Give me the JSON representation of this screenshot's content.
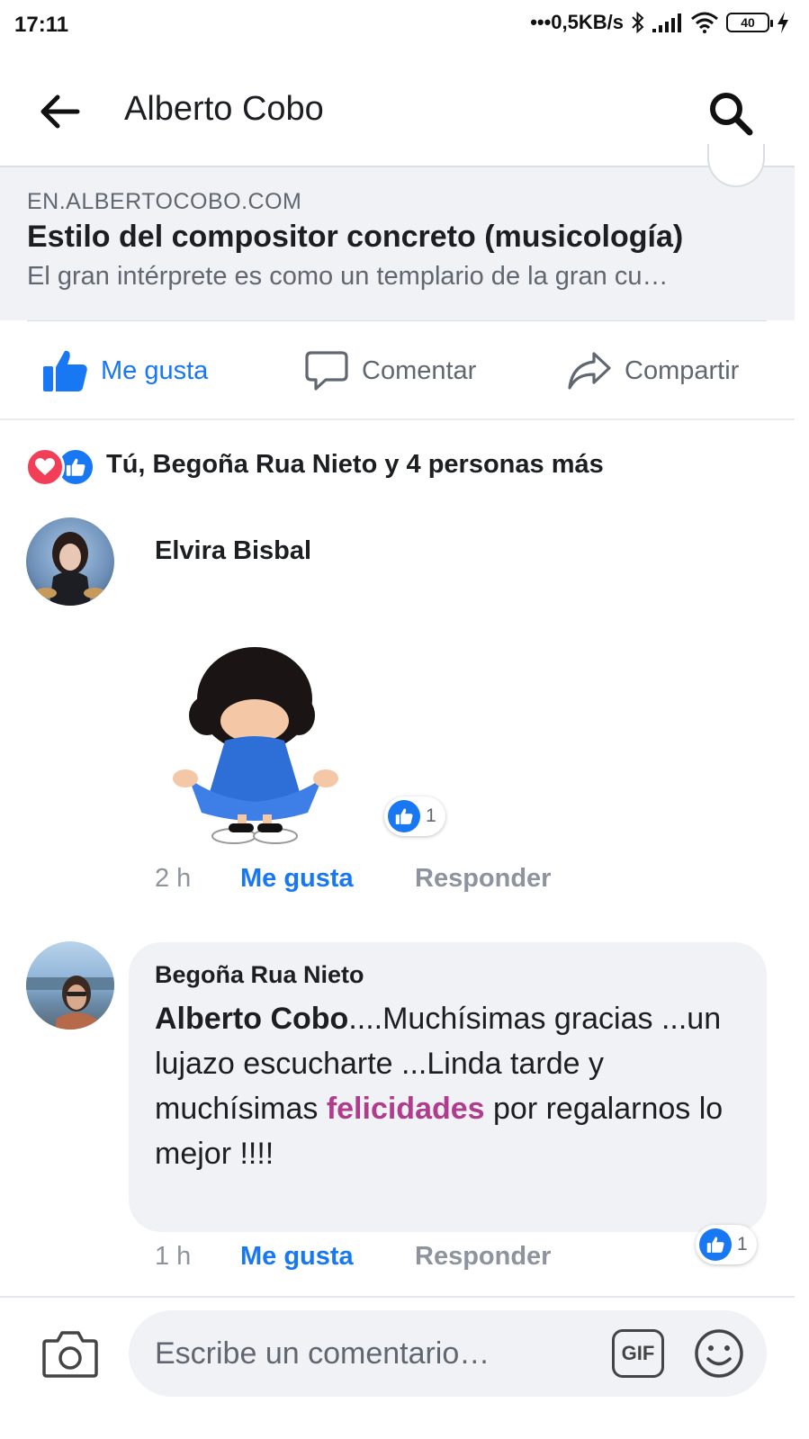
{
  "status_bar": {
    "time": "17:11",
    "network_speed": "•••0,5KB/s",
    "battery": "40",
    "icons": [
      "bluetooth-icon",
      "signal-icon",
      "wifi-icon",
      "battery-icon",
      "charging-icon"
    ]
  },
  "header": {
    "title": "Alberto Cobo",
    "back_icon": "arrow-left-icon",
    "search_icon": "search-icon"
  },
  "link_preview": {
    "domain": "EN.ALBERTOCOBO.COM",
    "title": "Estilo del compositor concreto (musicología)",
    "description": "El gran intérprete es como un templario de la gran cu…"
  },
  "actions": {
    "like": "Me gusta",
    "comment": "Comentar",
    "share": "Compartir"
  },
  "reactions": {
    "summary": "Tú, Begoña Rua Nieto y 4 personas más",
    "types": [
      "love",
      "like"
    ]
  },
  "comments": [
    {
      "author": "Elvira Bisbal",
      "content_type": "sticker",
      "reaction_count": "1",
      "time": "2 h",
      "like_label": "Me gusta",
      "reply_label": "Responder"
    },
    {
      "author": "Begoña Rua Nieto",
      "mention": "Alberto Cobo",
      "text_part1": "....Muchísimas gracias ...un lujazo escucharte ...Linda tarde y muchísimas ",
      "highlight": "felicidades",
      "text_part2": " por regalarnos lo mejor !!!!",
      "reaction_count": "1",
      "time": "1 h",
      "like_label": "Me gusta",
      "reply_label": "Responder"
    }
  ],
  "composer": {
    "placeholder": "Escribe un comentario…",
    "gif_label": "GIF"
  },
  "colors": {
    "accent": "#1877f2",
    "love": "#f33e58",
    "highlight": "#b03c8d",
    "secondary_text": "#606770"
  }
}
